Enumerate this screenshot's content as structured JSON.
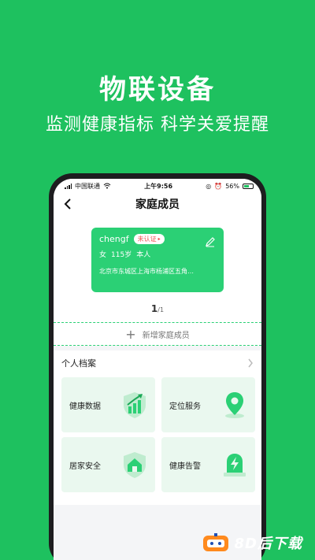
{
  "promo": {
    "headline": "物联设备",
    "subline": "监测健康指标 科学关爱提醒"
  },
  "status_bar": {
    "carrier": "中国联通",
    "time": "上午9:56",
    "battery": "56%"
  },
  "nav": {
    "title": "家庭成员"
  },
  "member_card": {
    "name": "chengf",
    "badge": "未认证",
    "gender": "女",
    "age": "115岁",
    "relation": "本人",
    "address": "北京市东城区上海市杨浦区五角…"
  },
  "pager": {
    "current": "1",
    "total": "/1"
  },
  "add_member": {
    "label": "新增家庭成员"
  },
  "archive": {
    "title": "个人档案",
    "tiles": [
      {
        "label": "健康数据",
        "icon": "chart-up-icon"
      },
      {
        "label": "定位服务",
        "icon": "location-pin-icon"
      },
      {
        "label": "居家安全",
        "icon": "home-shield-icon"
      },
      {
        "label": "健康告警",
        "icon": "lightning-alert-icon"
      }
    ]
  },
  "watermark": {
    "text": "8D后下载"
  },
  "colors": {
    "brand_green": "#1ec15f",
    "card_green": "#2bd075",
    "tile_bg": "#eaf8ef"
  }
}
